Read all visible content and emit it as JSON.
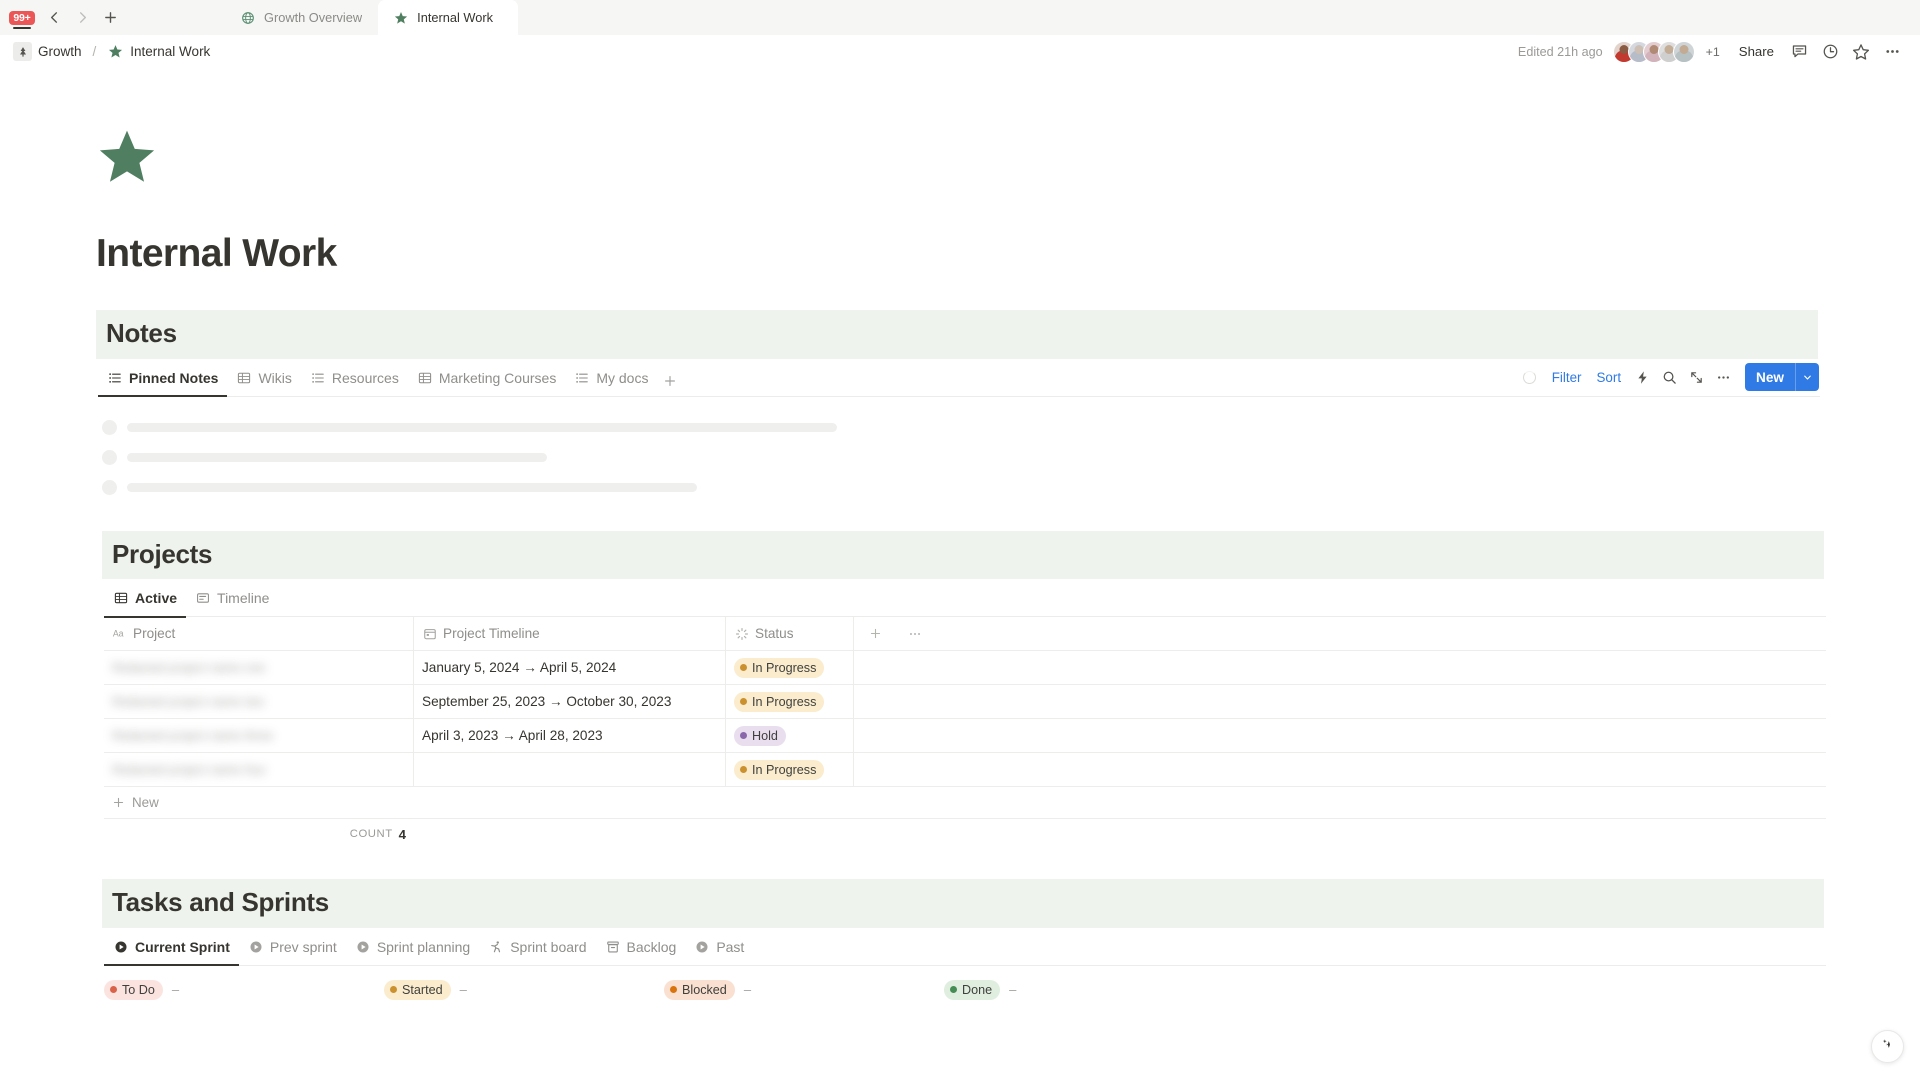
{
  "browser": {
    "notification_badge": "99+",
    "back_label": "Back",
    "forward_label": "Forward",
    "new_tab_label": "New tab",
    "tabs": [
      {
        "label": "Growth Overview",
        "icon": "globe-icon",
        "active": false
      },
      {
        "label": "Internal Work",
        "icon": "star-icon",
        "active": true
      }
    ]
  },
  "topbar": {
    "breadcrumb": [
      {
        "label": "Growth",
        "icon": "pine-tree-icon"
      },
      {
        "label": "Internal Work",
        "icon": "star-icon"
      }
    ],
    "separator": "/",
    "edited": "Edited 21h ago",
    "avatar_overflow": "+1",
    "share_label": "Share",
    "icons": [
      "comment-icon",
      "history-icon",
      "favorite-star-icon",
      "more-options-icon"
    ],
    "avatar_colors": [
      "#c97b6a",
      "#c9ccd6",
      "#d8b9bd",
      "#cfcfcf",
      "#b9bfc2"
    ]
  },
  "page": {
    "icon": "green-star-icon",
    "icon_color": "#4f7f60",
    "title": "Internal Work"
  },
  "sections": {
    "notes": {
      "heading": "Notes",
      "band_color": "#eef3ed",
      "views": [
        {
          "label": "Pinned Notes",
          "icon": "list-view-icon",
          "active": true
        },
        {
          "label": "Wikis",
          "icon": "table-view-icon",
          "active": false
        },
        {
          "label": "Resources",
          "icon": "list-view-icon",
          "active": false
        },
        {
          "label": "Marketing Courses",
          "icon": "table-view-icon",
          "active": false
        },
        {
          "label": "My docs",
          "icon": "list-view-icon",
          "active": false
        }
      ],
      "add_view_label": "+",
      "toolbar": {
        "loading": "loading-spinner",
        "filter_label": "Filter",
        "sort_label": "Sort",
        "automation_icon": "lightning-icon",
        "search_icon": "search-icon",
        "collapse_icon": "collapse-arrows-icon",
        "more_icon": "more-options-icon",
        "new_label": "New",
        "new_caret": "chevron-down-icon",
        "accent_color": "#2f7ae5"
      },
      "skeleton_bar_widths": [
        710,
        420,
        570
      ]
    },
    "projects": {
      "heading": "Projects",
      "band_color": "#eef3ed",
      "views": [
        {
          "label": "Active",
          "icon": "table-view-icon",
          "active": true
        },
        {
          "label": "Timeline",
          "icon": "timeline-view-icon",
          "active": false
        }
      ],
      "table": {
        "columns": [
          {
            "label": "Project",
            "icon": "title-aa-icon"
          },
          {
            "label": "Project Timeline",
            "icon": "date-icon"
          },
          {
            "label": "Status",
            "icon": "status-loading-icon"
          }
        ],
        "add_column_label": "+",
        "more_icon": "more-options-icon",
        "rows": [
          {
            "project": "Redacted project name one",
            "timeline": "January 5, 2024 → April 5, 2024",
            "status": "In Progress"
          },
          {
            "project": "Redacted project name two",
            "timeline": "September 25, 2023 → October 30, 2023",
            "status": "In Progress"
          },
          {
            "project": "Redacted project name three",
            "timeline": "April 3, 2023 → April 28, 2023",
            "status": "Hold"
          },
          {
            "project": "Redacted project name four",
            "timeline": "",
            "status": "In Progress"
          }
        ],
        "new_row_label": "New",
        "count_label": "COUNT",
        "count_value": "4"
      },
      "status_styles": {
        "In Progress": {
          "bg": "#faeccd",
          "dot": "#cb912f",
          "text": "#3f3f3c"
        },
        "Hold": {
          "bg": "#e8deee",
          "dot": "#8a67ab",
          "text": "#3f3f3c"
        }
      }
    },
    "tasks_and_sprints": {
      "heading": "Tasks and Sprints",
      "band_color": "#eef3ed",
      "views": [
        {
          "label": "Current Sprint",
          "icon": "play-circle-icon",
          "active": true
        },
        {
          "label": "Prev sprint",
          "icon": "play-circle-icon",
          "active": false
        },
        {
          "label": "Sprint planning",
          "icon": "play-circle-icon",
          "active": false
        },
        {
          "label": "Sprint board",
          "icon": "runner-icon",
          "active": false
        },
        {
          "label": "Backlog",
          "icon": "archive-icon",
          "active": false
        },
        {
          "label": "Past",
          "icon": "play-circle-icon",
          "active": false
        }
      ],
      "board_columns": [
        {
          "label": "To Do",
          "count": "–",
          "bg": "#fbe4e0",
          "dot": "#d9624b"
        },
        {
          "label": "Started",
          "count": "–",
          "bg": "#faeccd",
          "dot": "#cb912f"
        },
        {
          "label": "Blocked",
          "count": "–",
          "bg": "#fae0d0",
          "dot": "#d9730d"
        },
        {
          "label": "Done",
          "count": "–",
          "bg": "#dfeede",
          "dot": "#468c55"
        }
      ]
    }
  },
  "fab": {
    "icon": "ai-sparkle-icon"
  }
}
